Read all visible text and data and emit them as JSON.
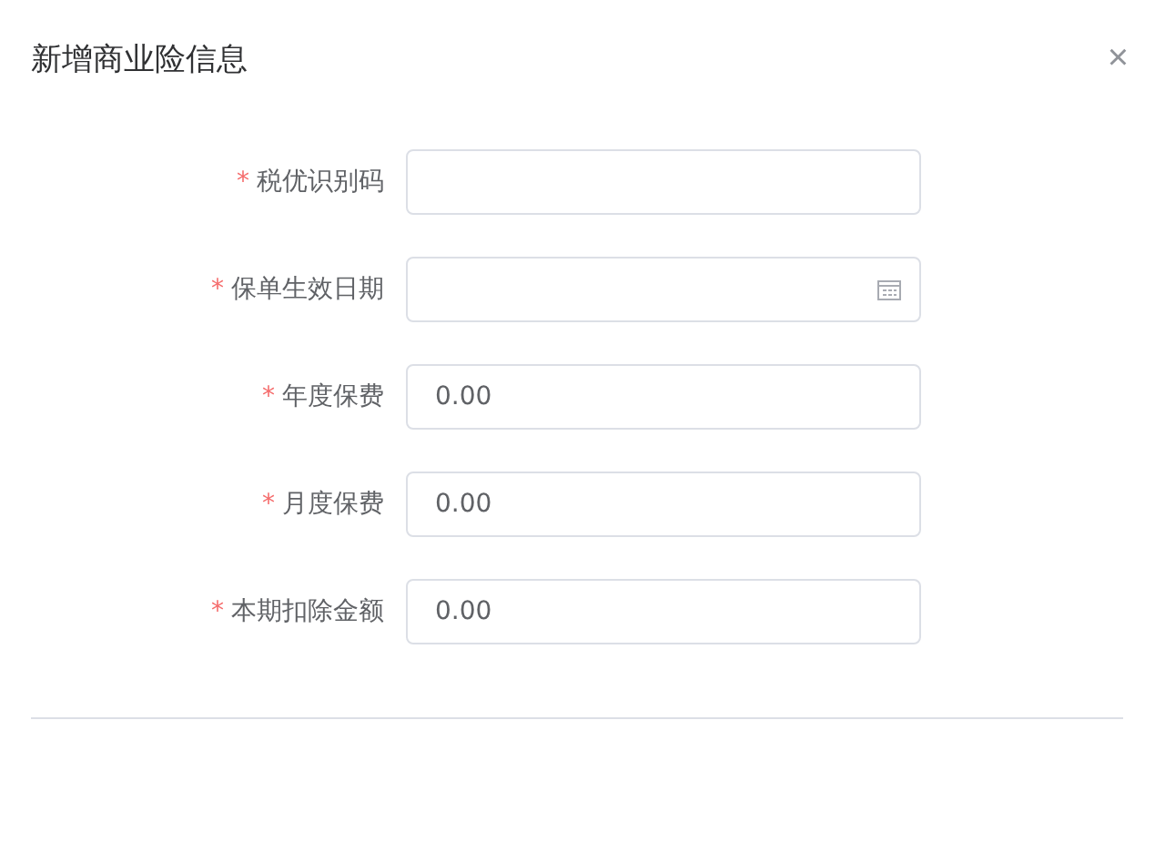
{
  "dialog": {
    "title": "新增商业险信息",
    "close": "×"
  },
  "fields": [
    {
      "label": "税优识别码",
      "required_mark": "*",
      "kind": "text"
    },
    {
      "label": "保单生效日期",
      "required_mark": "*",
      "kind": "date"
    },
    {
      "label": "年度保费",
      "required_mark": "*",
      "kind": "text",
      "value": "0.00"
    },
    {
      "label": "月度保费",
      "required_mark": "*",
      "kind": "text",
      "value": "0.00"
    },
    {
      "label": "本期扣除金额",
      "required_mark": "*",
      "kind": "text",
      "value": "0.00"
    }
  ]
}
